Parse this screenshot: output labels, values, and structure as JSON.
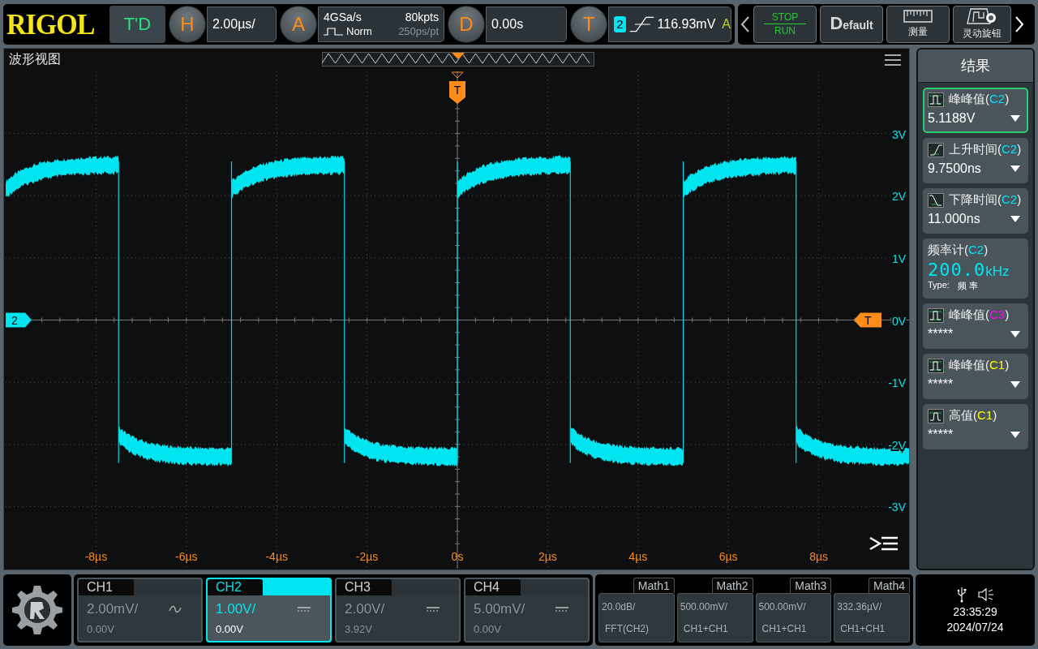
{
  "top_bar": {
    "logo": "RIGOL",
    "mode": "T'D",
    "horizontal": {
      "key": "H",
      "scale": "2.00µs/"
    },
    "acquire": {
      "key": "A",
      "sample_rate": "4GSa/s",
      "depth": "80kpts",
      "mode": "Norm",
      "resolution": "250ps/pt"
    },
    "delay": {
      "key": "D",
      "value": "0.00s"
    },
    "trigger": {
      "key": "T",
      "source": "2",
      "level": "116.93mV",
      "sweep": "A"
    },
    "run_stop": {
      "stop": "STOP",
      "run": "RUN"
    },
    "default_button": "Default",
    "tool_buttons": [
      {
        "kind": "ruler",
        "label": "测量"
      },
      {
        "kind": "knob",
        "label": "灵动旋钮"
      }
    ]
  },
  "waveform_view": {
    "title": "波形视图",
    "channel_marker": "2",
    "trigger_level_marker": "T",
    "trigger_position_marker": "T",
    "y_labels": [
      "3V",
      "2V",
      "1V",
      "0V",
      "-1V",
      "-2V",
      "-3V"
    ],
    "x_labels": [
      "-8µs",
      "-6µs",
      "-4µs",
      "-2µs",
      "0s",
      "2µs",
      "4µs",
      "6µs",
      "8µs"
    ]
  },
  "results": {
    "title": "结果",
    "items": [
      {
        "kind": "pkpk",
        "name": "峰峰值(",
        "source": "C2",
        "close": ")",
        "color": "#00e5ff",
        "value": "5.1188V",
        "selected": true
      },
      {
        "kind": "rise",
        "name": "上升时间(",
        "source": "C2",
        "close": ")",
        "color": "#00e5ff",
        "value": "9.7500ns",
        "selected": false
      },
      {
        "kind": "fall",
        "name": "下降时间(",
        "source": "C2",
        "close": ")",
        "color": "#00e5ff",
        "value": "11.000ns",
        "selected": false
      },
      {
        "kind": "counter",
        "name": "频率计(",
        "source": "C2",
        "close": ")",
        "color": "#00e5ff",
        "value": "200.0",
        "unit": "kHz",
        "type_label": "Type:",
        "type_value": "频 率",
        "selected": false
      },
      {
        "kind": "pkpk",
        "name": "峰峰值(",
        "source": "C3",
        "close": ")",
        "color": "#ff00ff",
        "value": "*****",
        "selected": false
      },
      {
        "kind": "pkpk",
        "name": "峰峰值(",
        "source": "C1",
        "close": ")",
        "color": "#ffff00",
        "value": "*****",
        "selected": false
      },
      {
        "kind": "high",
        "name": "高值(",
        "source": "C1",
        "close": ")",
        "color": "#ffff00",
        "value": "*****",
        "selected": false
      }
    ]
  },
  "channels": [
    {
      "kind": "ac",
      "name": "CH1",
      "scale": "2.00mV/",
      "offset": "0.00V",
      "selected": false
    },
    {
      "kind": "dc",
      "name": "CH2",
      "scale": "1.00V/",
      "offset": "0.00V",
      "selected": true
    },
    {
      "kind": "dc",
      "name": "CH3",
      "scale": "2.00V/",
      "offset": "3.92V",
      "selected": false
    },
    {
      "kind": "dc",
      "name": "CH4",
      "scale": "5.00mV/",
      "offset": "0.00V",
      "selected": false
    }
  ],
  "math": [
    {
      "name": "Math1",
      "scale": "20.0dB/",
      "source": "FFT(CH2)"
    },
    {
      "name": "Math2",
      "scale": "500.00mV/",
      "source": "CH1+CH1"
    },
    {
      "name": "Math3",
      "scale": "500.00mV/",
      "source": "CH1+CH1"
    },
    {
      "name": "Math4",
      "scale": "332.36µV/",
      "source": "CH1+CH1"
    }
  ],
  "status": {
    "time": "23:35:29",
    "date": "2024/07/24"
  }
}
